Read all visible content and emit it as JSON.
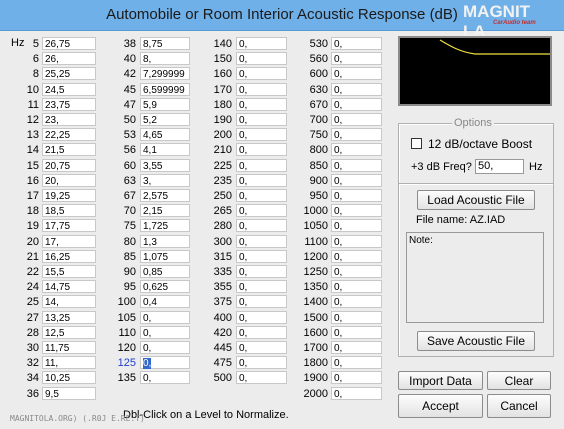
{
  "window": {
    "title": "Automobile or Room Interior Acoustic Response (dB)",
    "logo_text": "MAGNIT LA",
    "logo_subtext": "CarAudio team"
  },
  "hz_label": "Hz",
  "columns": [
    {
      "rows": [
        [
          "5",
          "26,75"
        ],
        [
          "6",
          "26,"
        ],
        [
          "8",
          "25,25"
        ],
        [
          "10",
          "24,5"
        ],
        [
          "11",
          "23,75"
        ],
        [
          "12",
          "23,"
        ],
        [
          "13",
          "22,25"
        ],
        [
          "14",
          "21,5"
        ],
        [
          "15",
          "20,75"
        ],
        [
          "16",
          "20,"
        ],
        [
          "17",
          "19,25"
        ],
        [
          "18",
          "18,5"
        ],
        [
          "19",
          "17,75"
        ],
        [
          "20",
          "17,"
        ],
        [
          "21",
          "16,25"
        ],
        [
          "22",
          "15,5"
        ],
        [
          "24",
          "14,75"
        ],
        [
          "25",
          "14,"
        ],
        [
          "27",
          "13,25"
        ],
        [
          "28",
          "12,5"
        ],
        [
          "30",
          "11,75"
        ],
        [
          "32",
          "11,"
        ],
        [
          "34",
          "10,25"
        ],
        [
          "36",
          "9,5"
        ]
      ]
    },
    {
      "rows": [
        [
          "38",
          "8,75"
        ],
        [
          "40",
          "8,"
        ],
        [
          "42",
          "7,299999"
        ],
        [
          "45",
          "6,599999"
        ],
        [
          "47",
          "5,9"
        ],
        [
          "50",
          "5,2"
        ],
        [
          "53",
          "4,65"
        ],
        [
          "56",
          "4,1"
        ],
        [
          "60",
          "3,55"
        ],
        [
          "63",
          "3,"
        ],
        [
          "67",
          "2,575"
        ],
        [
          "70",
          "2,15"
        ],
        [
          "75",
          "1,725"
        ],
        [
          "80",
          "1,3"
        ],
        [
          "85",
          "1,075"
        ],
        [
          "90",
          "0,85"
        ],
        [
          "95",
          "0,625"
        ],
        [
          "100",
          "0,4"
        ],
        [
          "105",
          "0,"
        ],
        [
          "110",
          "0,"
        ],
        [
          "120",
          "0,"
        ],
        [
          "125",
          "0,"
        ],
        [
          "135",
          "0,"
        ]
      ]
    },
    {
      "rows": [
        [
          "140",
          "0,"
        ],
        [
          "150",
          "0,"
        ],
        [
          "160",
          "0,"
        ],
        [
          "170",
          "0,"
        ],
        [
          "180",
          "0,"
        ],
        [
          "190",
          "0,"
        ],
        [
          "200",
          "0,"
        ],
        [
          "210",
          "0,"
        ],
        [
          "225",
          "0,"
        ],
        [
          "235",
          "0,"
        ],
        [
          "250",
          "0,"
        ],
        [
          "265",
          "0,"
        ],
        [
          "280",
          "0,"
        ],
        [
          "300",
          "0,"
        ],
        [
          "315",
          "0,"
        ],
        [
          "335",
          "0,"
        ],
        [
          "355",
          "0,"
        ],
        [
          "375",
          "0,"
        ],
        [
          "400",
          "0,"
        ],
        [
          "420",
          "0,"
        ],
        [
          "445",
          "0,"
        ],
        [
          "475",
          "0,"
        ],
        [
          "500",
          "0,"
        ]
      ]
    },
    {
      "rows": [
        [
          "530",
          "0,"
        ],
        [
          "560",
          "0,"
        ],
        [
          "600",
          "0,"
        ],
        [
          "630",
          "0,"
        ],
        [
          "670",
          "0,"
        ],
        [
          "700",
          "0,"
        ],
        [
          "750",
          "0,"
        ],
        [
          "800",
          "0,"
        ],
        [
          "850",
          "0,"
        ],
        [
          "900",
          "0,"
        ],
        [
          "950",
          "0,"
        ],
        [
          "1000",
          "0,"
        ],
        [
          "1050",
          "0,"
        ],
        [
          "1100",
          "0,"
        ],
        [
          "1200",
          "0,"
        ],
        [
          "1250",
          "0,"
        ],
        [
          "1350",
          "0,"
        ],
        [
          "1400",
          "0,"
        ],
        [
          "1500",
          "0,"
        ],
        [
          "1600",
          "0,"
        ],
        [
          "1700",
          "0,"
        ],
        [
          "1800",
          "0,"
        ],
        [
          "1900",
          "0,"
        ],
        [
          "2000",
          "0,"
        ]
      ]
    }
  ],
  "selected_frequency": "125",
  "options": {
    "group_title": "Options",
    "boost_label": "12 dB/octave Boost",
    "boost_checked": false,
    "freq_label": "+3 dB Freq?",
    "freq_value": "50,",
    "freq_unit": "Hz"
  },
  "file": {
    "load_label": "Load Acoustic File",
    "filename_text": "File name: AZ.IAD",
    "note_label": "Note:",
    "save_label": "Save Acoustic File"
  },
  "buttons": {
    "import": "Import Data",
    "clear": "Clear",
    "accept": "Accept",
    "cancel": "Cancel"
  },
  "hint": "Dbl-Click on a Level to Normalize.",
  "watermark": "MAGNITOLA.ORG) (.R0J E.RE.T)",
  "colors": {
    "titlebar": "#6fb0e8",
    "selection": "#3466cc",
    "active_label": "#2040d0",
    "curve": "#f0e040"
  }
}
